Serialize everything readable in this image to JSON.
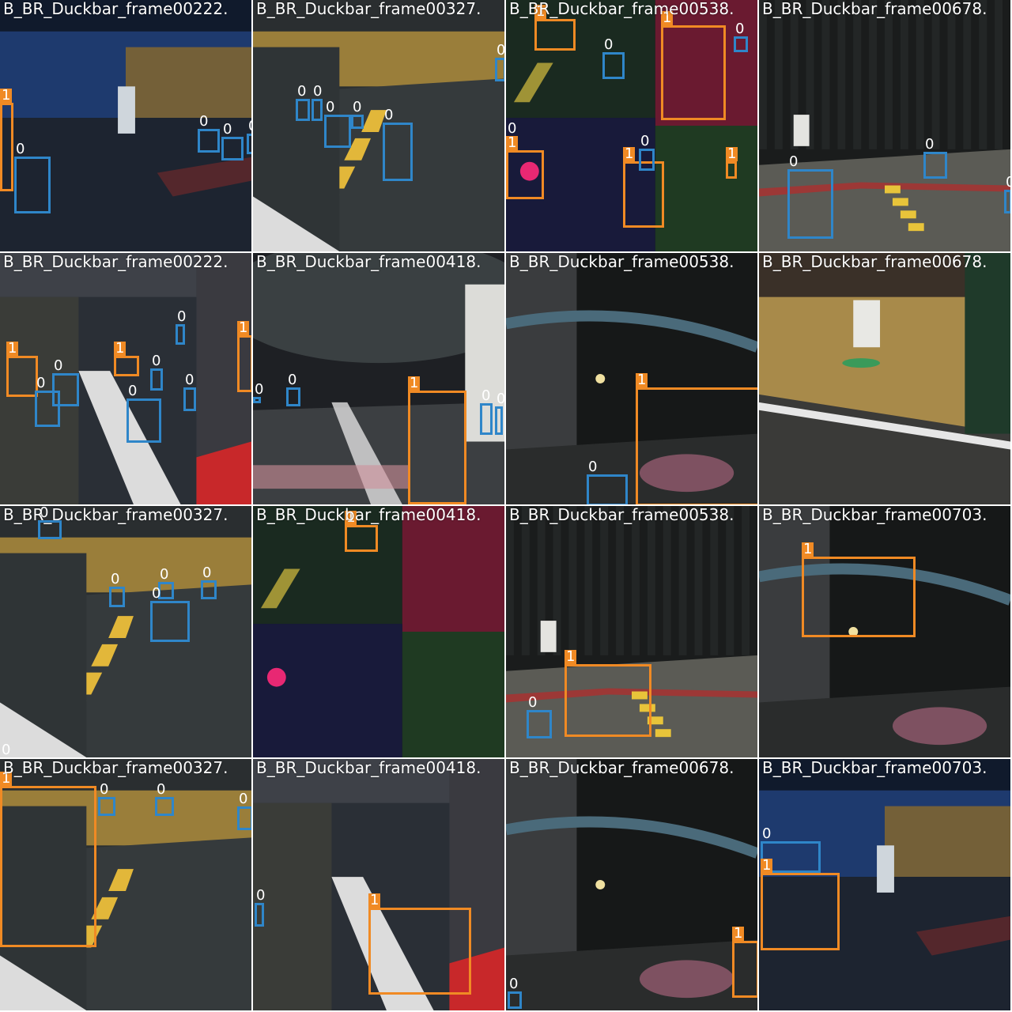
{
  "colors": {
    "class_0": "#2f86c9",
    "class_1": "#f08a24",
    "label_text": "#ffffff"
  },
  "classes": [
    "0",
    "1"
  ],
  "tiles": [
    {
      "filename": "B_BR_Duckbar_frame00222.",
      "scene": "night-hall"
    },
    {
      "filename": "B_BR_Duckbar_frame00327.",
      "scene": "road-yellow"
    },
    {
      "filename": "B_BR_Duckbar_frame00538.",
      "scene": "mosaic-night"
    },
    {
      "filename": "B_BR_Duckbar_frame00678.",
      "scene": "curtain-road"
    },
    {
      "filename": "B_BR_Duckbar_frame00222.",
      "scene": "mosaic-city"
    },
    {
      "filename": "B_BR_Duckbar_frame00418.",
      "scene": "hall-road"
    },
    {
      "filename": "B_BR_Duckbar_frame00538.",
      "scene": "dark-car"
    },
    {
      "filename": "B_BR_Duckbar_frame00678.",
      "scene": "tan-wall"
    },
    {
      "filename": "B_BR_Duckbar_frame00327.",
      "scene": "road-yellow"
    },
    {
      "filename": "B_BR_Duckbar_frame00418.",
      "scene": "mosaic-night"
    },
    {
      "filename": "B_BR_Duckbar_frame00538.",
      "scene": "curtain-road"
    },
    {
      "filename": "B_BR_Duckbar_frame00703.",
      "scene": "dark-car"
    },
    {
      "filename": "B_BR_Duckbar_frame00327.",
      "scene": "road-yellow"
    },
    {
      "filename": "B_BR_Duckbar_frame00418.",
      "scene": "mosaic-city"
    },
    {
      "filename": "B_BR_Duckbar_frame00678.",
      "scene": "dark-car"
    },
    {
      "filename": "B_BR_Duckbar_frame00703.",
      "scene": "night-hall"
    }
  ]
}
